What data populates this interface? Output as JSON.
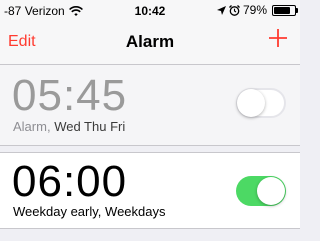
{
  "statusbar": {
    "signal": "-87",
    "carrier": "Verizon",
    "time": "10:42",
    "battery": "79%",
    "battery_level": 0.79
  },
  "navbar": {
    "edit_label": "Edit",
    "title": "Alarm",
    "add_icon": "plus-icon"
  },
  "alarms": [
    {
      "time": "05:45",
      "name": "Alarm,",
      "repeat": "Wed Thu Fri",
      "enabled": false
    },
    {
      "time": "06:00",
      "name": "Weekday early,",
      "repeat": "Weekdays",
      "enabled": true
    }
  ],
  "colors": {
    "accent": "#ff3b30",
    "toggle_on": "#4cd964"
  }
}
